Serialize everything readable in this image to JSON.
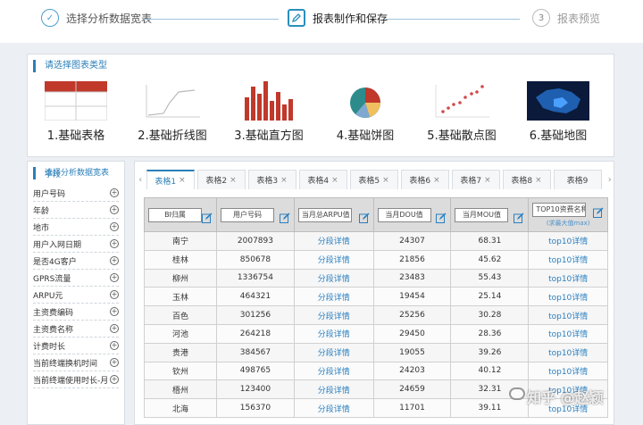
{
  "stepper": {
    "steps": [
      {
        "num": "✓",
        "label": "选择分析数据宽表"
      },
      {
        "num": "",
        "label": "报表制作和保存"
      },
      {
        "num": "3",
        "label": "报表预览"
      }
    ]
  },
  "chart_panel": {
    "title": "请选择图表类型",
    "types": [
      {
        "label": "1.基础表格",
        "icon": "table-icon"
      },
      {
        "label": "2.基础折线图",
        "icon": "line-chart-icon"
      },
      {
        "label": "3.基础直方图",
        "icon": "bar-chart-icon"
      },
      {
        "label": "4.基础饼图",
        "icon": "pie-chart-icon"
      },
      {
        "label": "5.基础散点图",
        "icon": "scatter-chart-icon"
      },
      {
        "label": "6.基础地图",
        "icon": "map-icon"
      }
    ]
  },
  "field_panel": {
    "title": "选择分析数据宽表字段",
    "fields": [
      "用户号码",
      "年龄",
      "地市",
      "用户入网日期",
      "是否4G客户",
      "GPRS流量",
      "ARPU元",
      "主资费编码",
      "主资费名称",
      "计费时长",
      "当前终端换机时间",
      "当前终端使用时长-月"
    ]
  },
  "tabs": [
    "表格1",
    "表格2",
    "表格3",
    "表格4",
    "表格5",
    "表格6",
    "表格7",
    "表格8",
    "表格9"
  ],
  "table": {
    "headers": [
      "BI归属",
      "用户号码",
      "当月总ARPU值",
      "当月DOU值",
      "当月MOU值",
      "TOP10资费名称"
    ],
    "top10_note": "(求最大值max)",
    "rows": [
      [
        "南宁",
        "2007893",
        "分段详情",
        "24307",
        "68.31",
        "top10详情"
      ],
      [
        "桂林",
        "850678",
        "分段详情",
        "21856",
        "45.62",
        "top10详情"
      ],
      [
        "柳州",
        "1336754",
        "分段详情",
        "23483",
        "55.43",
        "top10详情"
      ],
      [
        "玉林",
        "464321",
        "分段详情",
        "19454",
        "25.14",
        "top10详情"
      ],
      [
        "百色",
        "301256",
        "分段详情",
        "25256",
        "30.28",
        "top10详情"
      ],
      [
        "河池",
        "264218",
        "分段详情",
        "29450",
        "28.36",
        "top10详情"
      ],
      [
        "贵港",
        "384567",
        "分段详情",
        "19055",
        "39.26",
        "top10详情"
      ],
      [
        "钦州",
        "498765",
        "分段详情",
        "24203",
        "40.12",
        "top10详情"
      ],
      [
        "梧州",
        "123400",
        "分段详情",
        "24659",
        "32.31",
        "top10详情"
      ],
      [
        "北海",
        "156370",
        "分段详情",
        "11701",
        "39.11",
        "top10详情"
      ]
    ]
  },
  "watermark": "知乎 @赵颖",
  "colors": {
    "accent": "#2a7fb8",
    "bar": "#c0392b"
  }
}
